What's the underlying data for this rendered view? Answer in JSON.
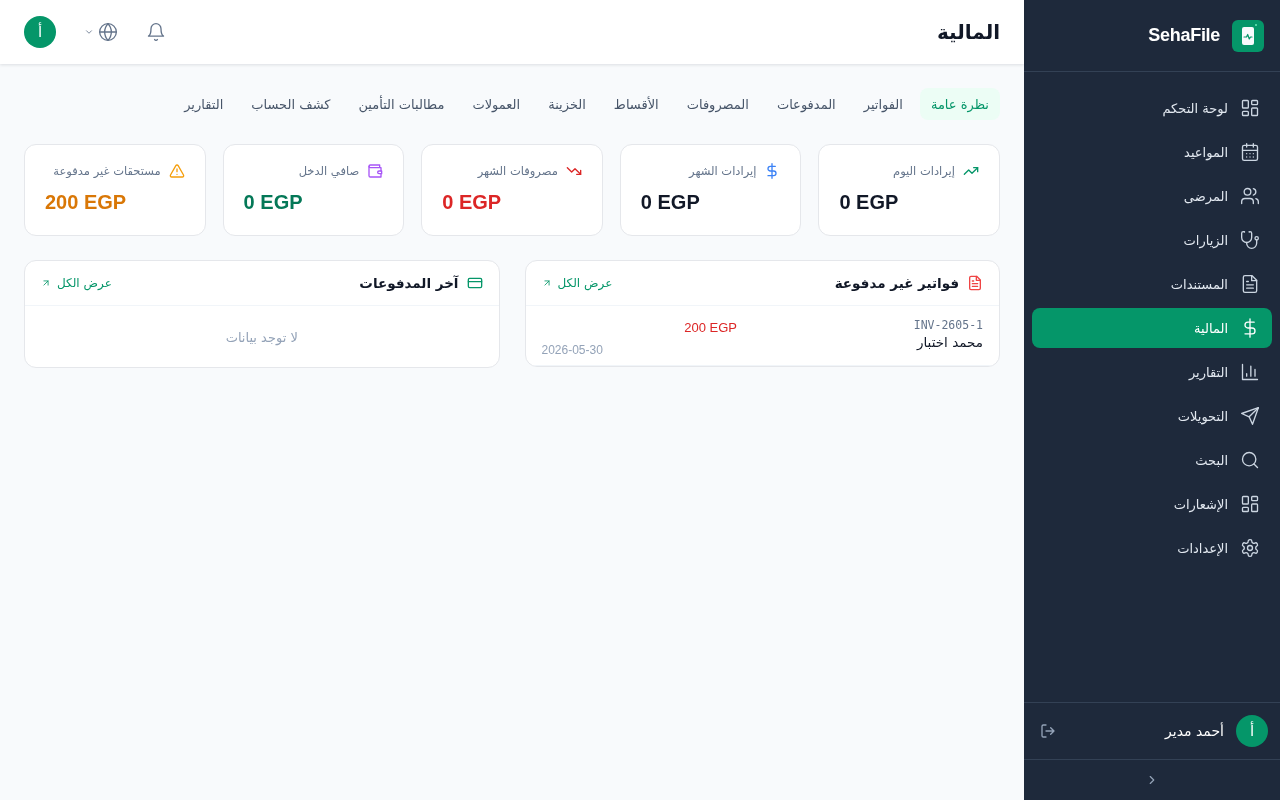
{
  "sidebar": {
    "brand": "SehaFile",
    "items": [
      {
        "label": "لوحة التحكم",
        "kind": "grid",
        "selected": false
      },
      {
        "label": "المواعيد",
        "kind": "calendar",
        "selected": false
      },
      {
        "label": "المرضى",
        "kind": "people",
        "selected": false
      },
      {
        "label": "الزيارات",
        "kind": "stethoscope",
        "selected": false
      },
      {
        "label": "المستندات",
        "kind": "document",
        "selected": false
      },
      {
        "label": "المالية",
        "kind": "dollar",
        "selected": true
      },
      {
        "label": "التقارير",
        "kind": "bars",
        "selected": false
      },
      {
        "label": "التحويلات",
        "kind": "plane",
        "selected": false
      },
      {
        "label": "البحث",
        "kind": "search",
        "selected": false
      },
      {
        "label": "الإشعارات",
        "kind": "grid",
        "selected": false
      },
      {
        "label": "الإعدادات",
        "kind": "gear",
        "selected": false
      }
    ],
    "user": {
      "avatar": "أ",
      "name": "أحمد مدير"
    }
  },
  "header": {
    "title": "المالية",
    "avatar": "أ"
  },
  "tabs": [
    {
      "label": "نظرة عامة",
      "selected": true
    },
    {
      "label": "الفواتير",
      "selected": false
    },
    {
      "label": "المدفوعات",
      "selected": false
    },
    {
      "label": "المصروفات",
      "selected": false
    },
    {
      "label": "الأقساط",
      "selected": false
    },
    {
      "label": "الخزينة",
      "selected": false
    },
    {
      "label": "العمولات",
      "selected": false
    },
    {
      "label": "مطالبات التأمين",
      "selected": false
    },
    {
      "label": "كشف الحساب",
      "selected": false
    },
    {
      "label": "التقارير",
      "selected": false
    }
  ],
  "stat_cards": [
    {
      "label": "إيرادات اليوم",
      "value": "0 EGP",
      "kind": "rise",
      "color": "#111827"
    },
    {
      "label": "إيرادات الشهر",
      "value": "0 EGP",
      "kind": "dollar",
      "color": "#111827"
    },
    {
      "label": "مصروفات الشهر",
      "value": "0 EGP",
      "kind": "fall",
      "color": "#dc2626"
    },
    {
      "label": "صافي الدخل",
      "value": "0 EGP",
      "kind": "wallet",
      "color": "#047857"
    },
    {
      "label": "مستحقات غير مدفوعة",
      "value": "200 EGP",
      "kind": "warning",
      "color": "#d97706"
    }
  ],
  "panels": [
    {
      "kind": "document",
      "title": "فواتير غير مدفوعة",
      "link": "عرض الكل",
      "rows": [
        {
          "number": "INV-2605-1",
          "name": "محمد اختبار",
          "amount": "200 EGP",
          "date": "2026-05-30"
        }
      ]
    },
    {
      "kind": "card",
      "title": "آخر المدفوعات",
      "link": "عرض الكل",
      "empty_text": "لا توجد بيانات"
    }
  ]
}
